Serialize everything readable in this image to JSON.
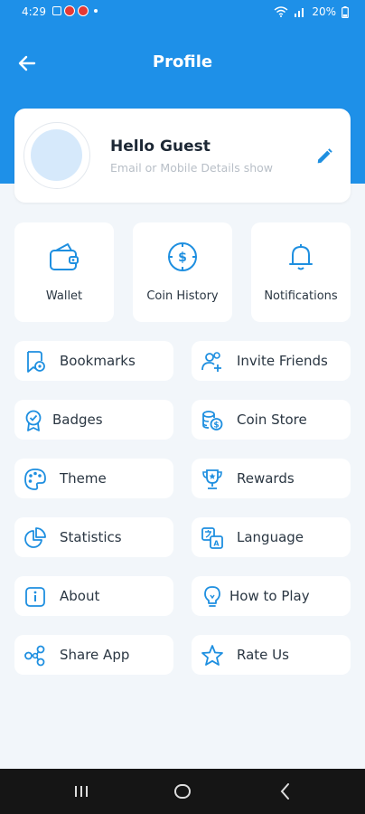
{
  "status_bar": {
    "time": "4:29",
    "battery": "20%"
  },
  "header": {
    "title": "Profile"
  },
  "profile": {
    "greeting": "Hello Guest",
    "subtitle": "Email or Mobile Details show"
  },
  "tiles": [
    {
      "label": "Wallet",
      "icon": "wallet-icon"
    },
    {
      "label": "Coin History",
      "icon": "coin-history-icon"
    },
    {
      "label": "Notifications",
      "icon": "bell-icon"
    }
  ],
  "menu": [
    {
      "label": "Bookmarks",
      "icon": "bookmark-icon"
    },
    {
      "label": "Invite Friends",
      "icon": "invite-friends-icon"
    },
    {
      "label": "Badges",
      "icon": "badge-icon"
    },
    {
      "label": "Coin Store",
      "icon": "coin-store-icon"
    },
    {
      "label": "Theme",
      "icon": "palette-icon"
    },
    {
      "label": "Rewards",
      "icon": "trophy-icon"
    },
    {
      "label": "Statistics",
      "icon": "pie-chart-icon"
    },
    {
      "label": "Language",
      "icon": "language-icon"
    },
    {
      "label": "About",
      "icon": "info-icon"
    },
    {
      "label": "How to Play",
      "icon": "lightbulb-icon"
    },
    {
      "label": "Share App",
      "icon": "share-icon"
    },
    {
      "label": "Rate Us",
      "icon": "star-icon"
    }
  ],
  "colors": {
    "primary": "#1e90e8",
    "background": "#f2f6fa",
    "card": "#ffffff"
  }
}
